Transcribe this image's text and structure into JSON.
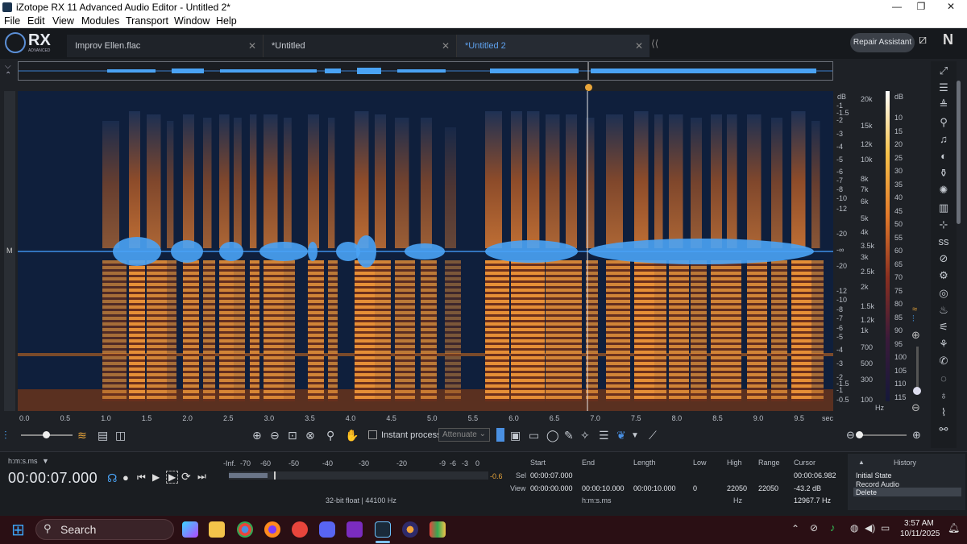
{
  "window": {
    "title": "iZotope RX 11 Advanced Audio Editor - Untitled 2*",
    "min": "—",
    "max": "❐",
    "close": "✕"
  },
  "menu": [
    "File",
    "Edit",
    "View",
    "Modules",
    "Transport",
    "Window",
    "Help"
  ],
  "logo": {
    "text": "RX",
    "sub": "ADVANCED"
  },
  "tabs": [
    {
      "label": "Improv Ellen.flac",
      "active": false
    },
    {
      "label": "*Untitled",
      "active": false
    },
    {
      "label": "*Untitled 2",
      "active": true
    }
  ],
  "repair_assistant": "Repair Assistant",
  "channel_label": "M",
  "db_scale": {
    "header": "dB",
    "upper": [
      "-1",
      "-1.5",
      "-2",
      "-3",
      "-4",
      "-5",
      "-6",
      "-7",
      "-8",
      "-10",
      "-12",
      "-20",
      "-∞",
      "-20"
    ],
    "lower": [
      "-12",
      "-10",
      "-8",
      "-7",
      "-6",
      "-5",
      "-4",
      "-3",
      "-2",
      "-1.5",
      "-1",
      "-0.5"
    ]
  },
  "freq_scale": {
    "labels": [
      "20k",
      "15k",
      "12k",
      "10k",
      "8k",
      "7k",
      "6k",
      "5k",
      "4k",
      "3.5k",
      "3k",
      "2.5k",
      "2k",
      "1.5k",
      "1.2k",
      "1k",
      "700",
      "500",
      "300",
      "100"
    ],
    "unit": "Hz"
  },
  "colorbar": {
    "header": "dB",
    "labels": [
      "10",
      "15",
      "20",
      "25",
      "30",
      "35",
      "40",
      "45",
      "50",
      "55",
      "60",
      "65",
      "70",
      "75",
      "80",
      "85",
      "90",
      "95",
      "100",
      "105",
      "110",
      "115"
    ]
  },
  "time_axis": {
    "labels": [
      "0.0",
      "0.5",
      "1.0",
      "1.5",
      "2.0",
      "2.5",
      "3.0",
      "3.5",
      "4.0",
      "4.5",
      "5.0",
      "5.5",
      "6.0",
      "6.5",
      "7.0",
      "7.5",
      "8.0",
      "8.5",
      "9.0",
      "9.5"
    ],
    "unit": "sec"
  },
  "toolbar": {
    "instant_process": "Instant process",
    "attenuate": "Attenuate"
  },
  "transport": {
    "time_format": "h:m:s.ms",
    "time": "00:00:07.000"
  },
  "meter": {
    "labels": [
      "-Inf.",
      "-70",
      "-60",
      "-50",
      "-40",
      "-30",
      "-20",
      "-9",
      "-6",
      "-3",
      "0"
    ],
    "peak": "-0.6",
    "format": "32-bit float | 44100 Hz"
  },
  "selection": {
    "headers": [
      "Start",
      "End",
      "Length"
    ],
    "sel_label": "Sel",
    "view_label": "View",
    "sel_start": "00:00:07.000",
    "view_start": "00:00:00.000",
    "view_end": "00:00:10.000",
    "view_length": "00:00:10.000",
    "unit": "h:m:s.ms"
  },
  "freq_range": {
    "headers": [
      "Low",
      "High",
      "Range"
    ],
    "low": "0",
    "high": "22050",
    "range": "22050",
    "unit": "Hz"
  },
  "cursor": {
    "header": "Cursor",
    "time": "00:00:06.982",
    "db": "-43.2 dB",
    "hz": "12967.7 Hz"
  },
  "history": {
    "header": "History",
    "items": [
      "Initial State",
      "Record Audio",
      "Delete"
    ],
    "selected": 2
  },
  "taskbar": {
    "search": "Search",
    "time": "3:57 AM",
    "date": "10/11/2025"
  },
  "colors": {
    "accent": "#4a90e2",
    "playhead": "#e8a53a",
    "spectrogram_low": "#0f1f3c",
    "spectrogram_high": "#f09a3a",
    "waveform": "#4aa3f5"
  }
}
